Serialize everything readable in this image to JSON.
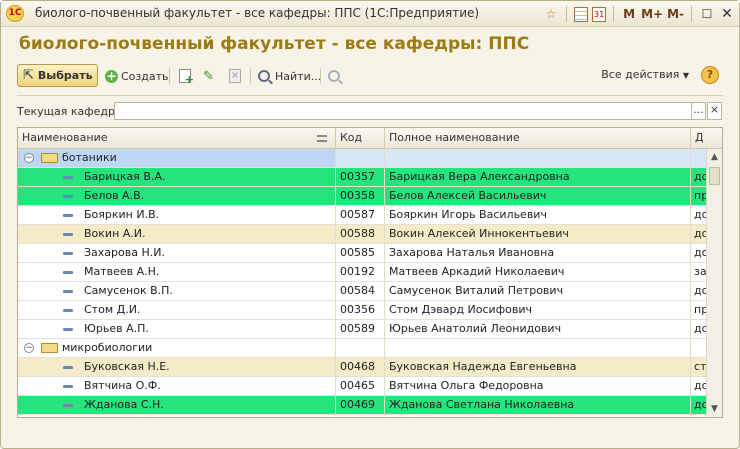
{
  "window": {
    "title": "биолого-почвенный факультет - все кафедры: ППС (1С:Предприятие)",
    "logo": "1С",
    "icons": [
      "star-icon",
      "calendar-grid-icon",
      "calendar-icon"
    ],
    "calendar_day": "31",
    "m_buttons": [
      "M",
      "M+",
      "M-"
    ]
  },
  "form": {
    "title": "биолого-почвенный факультет - все кафедры: ППС"
  },
  "toolbar": {
    "choose_label": "Выбрать",
    "create_label": "Создать",
    "find_label": "Найти...",
    "all_actions_label": "Все действия",
    "help_label": "?"
  },
  "filter": {
    "label": "Текущая кафедра:",
    "value": "",
    "select_button": "...",
    "clear_button": "×"
  },
  "table": {
    "columns": [
      "Наименование",
      "Код",
      "Полное наименование",
      "Д"
    ],
    "rows": [
      {
        "type": "group",
        "name": "ботаники",
        "code": "",
        "full": "",
        "pos": "",
        "style": "group-sel"
      },
      {
        "type": "item",
        "name": "Барицкая В.А.",
        "code": "00357",
        "full": "Барицкая Вера Александровна",
        "pos": "до",
        "style": "green"
      },
      {
        "type": "item",
        "name": "Белов А.В.",
        "code": "00358",
        "full": "Белов Алексей Васильевич",
        "pos": "пр",
        "style": "green"
      },
      {
        "type": "item",
        "name": "Бояркин И.В.",
        "code": "00587",
        "full": "Бояркин Игорь Васильевич",
        "pos": "до",
        "style": "white"
      },
      {
        "type": "item",
        "name": "Вокин А.И.",
        "code": "00588",
        "full": "Вокин Алексей Иннокентьевич",
        "pos": "до",
        "style": "beige"
      },
      {
        "type": "item",
        "name": "Захарова Н.И.",
        "code": "00585",
        "full": "Захарова Наталья Ивановна",
        "pos": "до",
        "style": "white"
      },
      {
        "type": "item",
        "name": "Матвеев А.Н.",
        "code": "00192",
        "full": "Матвеев Аркадий Николаевич",
        "pos": "за",
        "style": "white"
      },
      {
        "type": "item",
        "name": "Самусенок В.П.",
        "code": "00584",
        "full": "Самусенок Виталий Петрович",
        "pos": "до",
        "style": "white"
      },
      {
        "type": "item",
        "name": "Стом Д.И.",
        "code": "00356",
        "full": "Стом Дэвард Иосифович",
        "pos": "пр",
        "style": "white"
      },
      {
        "type": "item",
        "name": "Юрьев А.П.",
        "code": "00589",
        "full": "Юрьев Анатолий Леонидович",
        "pos": "до",
        "style": "white"
      },
      {
        "type": "group",
        "name": "микробиологии",
        "code": "",
        "full": "",
        "pos": "",
        "style": "white"
      },
      {
        "type": "item",
        "name": "Буковская Н.Е.",
        "code": "00468",
        "full": "Буковская Надежда Евгеньевна",
        "pos": "ст",
        "style": "beige"
      },
      {
        "type": "item",
        "name": "Вятчина О.Ф.",
        "code": "00465",
        "full": "Вятчина Ольга Федоровна",
        "pos": "до",
        "style": "white"
      },
      {
        "type": "item",
        "name": "Жданова С.Н.",
        "code": "00469",
        "full": "Жданова Светлана Николаевна",
        "pos": "до",
        "style": "green"
      }
    ]
  }
}
